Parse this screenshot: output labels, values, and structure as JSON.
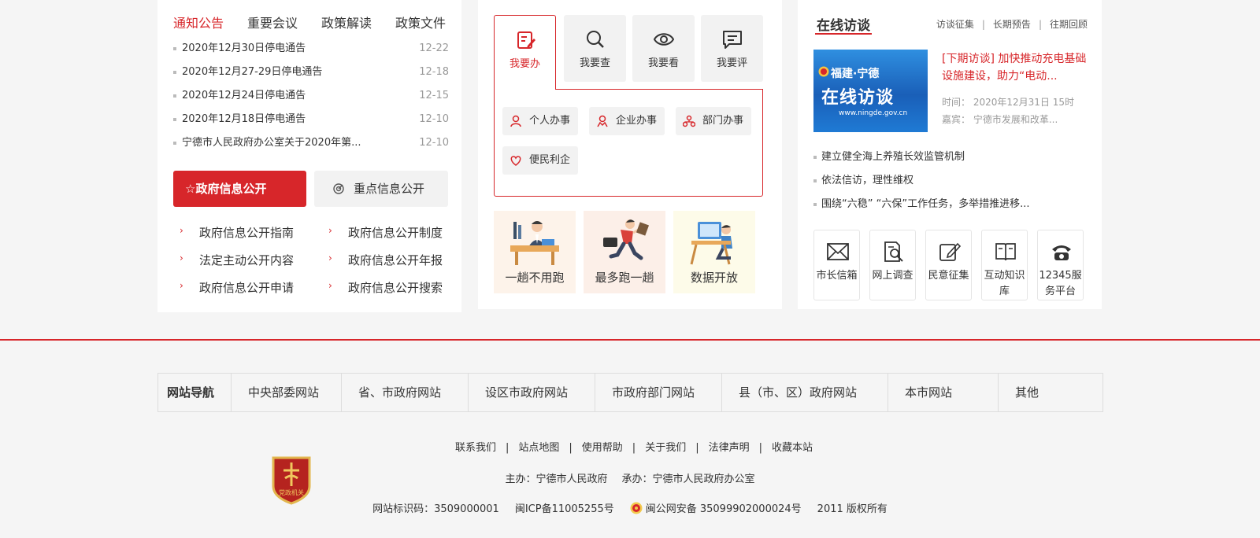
{
  "colors": {
    "accent": "#d7262a",
    "muted": "#999999",
    "text": "#333333"
  },
  "notice": {
    "tabs": [
      "通知公告",
      "重要会议",
      "政策解读",
      "政策文件"
    ],
    "items": [
      {
        "title": "2020年12月30日停电通告",
        "date": "12-22"
      },
      {
        "title": "2020年12月27-29日停电通告",
        "date": "12-18"
      },
      {
        "title": "2020年12月24日停电通告",
        "date": "12-15"
      },
      {
        "title": "2020年12月18日停电通告",
        "date": "12-10"
      },
      {
        "title": "宁德市人民政府办公室关于2020年第...",
        "date": "12-10"
      }
    ]
  },
  "info": {
    "primary_button": "☆政府信息公开",
    "secondary_button": "重点信息公开",
    "links": [
      "政府信息公开指南",
      "政府信息公开制度",
      "法定主动公开内容",
      "政府信息公开年报",
      "政府信息公开申请",
      "政府信息公开搜索"
    ]
  },
  "services": {
    "tabs": [
      {
        "label": "我要办",
        "icon": "form-edit-icon"
      },
      {
        "label": "我要查",
        "icon": "search-icon"
      },
      {
        "label": "我要看",
        "icon": "eye-icon"
      },
      {
        "label": "我要评",
        "icon": "comment-icon"
      }
    ],
    "chips": [
      {
        "label": "个人办事",
        "icon": "person-icon"
      },
      {
        "label": "企业办事",
        "icon": "business-person-icon"
      },
      {
        "label": "部门办事",
        "icon": "org-chart-icon"
      },
      {
        "label": "便民利企",
        "icon": "heart-icon"
      }
    ],
    "cards": [
      {
        "label": "一趟不用跑",
        "bg": "#fdf3ea"
      },
      {
        "label": "最多跑一趟",
        "bg": "#fcefe8"
      },
      {
        "label": "数据开放",
        "bg": "#fdfbe9"
      }
    ]
  },
  "online": {
    "title": "在线访谈",
    "links": [
      "访谈征集",
      "长期预告",
      "往期回顾"
    ],
    "thumb": {
      "line1": "福建·宁德",
      "line2": "在线访谈",
      "line3": "www.ningde.gov.cn"
    },
    "headline": "[下期访谈] 加快推动充电基础设施建设，助力“电动...",
    "time_label": "时间：",
    "time_value": "2020年12月31日 15时",
    "guest_label": "嘉宾：",
    "guest_value": "宁德市发展和改革...",
    "items": [
      "建立健全海上养殖长效监管机制",
      "依法信访，理性维权",
      "围绕“六稳” “六保”工作任务，多举措推进移..."
    ],
    "interactions": [
      {
        "label": "市长信箱",
        "icon": "mail-icon"
      },
      {
        "label": "网上调查",
        "icon": "survey-search-icon"
      },
      {
        "label": "民意征集",
        "icon": "edit-icon"
      },
      {
        "label": "互动知识库",
        "icon": "book-icon"
      },
      {
        "label": "12345服务平台",
        "icon": "phone-icon"
      }
    ]
  },
  "footer": {
    "nav_title": "网站导航",
    "nav_items": [
      "中央部委网站",
      "省、市政府网站",
      "设区市政府网站",
      "市政府部门网站",
      "县（市、区）政府网站",
      "本市网站",
      "其他"
    ],
    "links": [
      "联系我们",
      "站点地图",
      "使用帮助",
      "关于我们",
      "法律声明",
      "收藏本站"
    ],
    "host": "主办：宁德市人民政府",
    "undertaker": "承办：宁德市人民政府办公室",
    "site_code": "网站标识码：3509000001",
    "icp": "闽ICP备11005255号",
    "police": "闽公网安备 35099902000024号",
    "copyright": "2011 版权所有",
    "badge_text": "党政机关"
  }
}
